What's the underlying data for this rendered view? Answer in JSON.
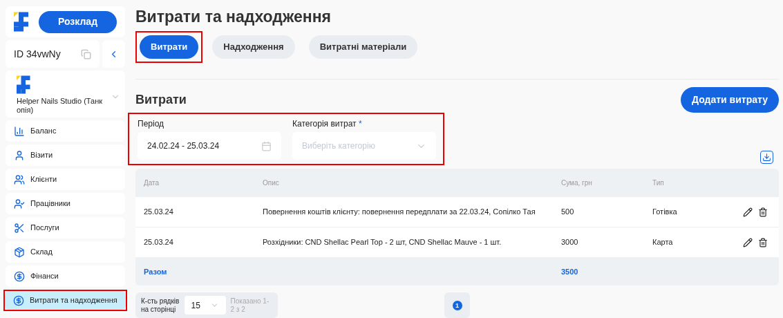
{
  "sidebar": {
    "schedule_button": "Розклад",
    "account_id": "ID 34vwNy",
    "studio": "Helper Nails Studio (Танкопія)",
    "items": [
      {
        "label": "Баланс",
        "selected": false,
        "highlighted": false
      },
      {
        "label": "Візити",
        "selected": false,
        "highlighted": false
      },
      {
        "label": "Клієнти",
        "selected": false,
        "highlighted": false
      },
      {
        "label": "Працівники",
        "selected": false,
        "highlighted": false
      },
      {
        "label": "Послуги",
        "selected": false,
        "highlighted": false
      },
      {
        "label": "Склад",
        "selected": false,
        "highlighted": false
      },
      {
        "label": "Фінанси",
        "selected": false,
        "highlighted": false
      },
      {
        "label": "Витрати та надходження",
        "selected": true,
        "highlighted": true
      }
    ]
  },
  "page_title": "Витрати та надходження",
  "tabs": [
    {
      "label": "Витрати",
      "selected": true,
      "highlighted": true
    },
    {
      "label": "Надходження",
      "selected": false,
      "highlighted": false
    },
    {
      "label": "Витратні матеріали",
      "selected": false,
      "highlighted": false
    }
  ],
  "section_title": "Витрати",
  "add_button": "Додати витрату",
  "filters": {
    "highlighted": true,
    "period": {
      "label": "Період",
      "value": "24.02.24 - 25.03.24"
    },
    "category": {
      "label": "Категорія витрат",
      "required_mark": "*",
      "placeholder": "Виберіть категорію"
    }
  },
  "table": {
    "columns": [
      "Дата",
      "Опис",
      "Сума, грн",
      "Тип"
    ],
    "rows": [
      [
        "25.03.24",
        "Повернення коштів клієнту: повернення передплати за 22.03.24, Сопілко Тая",
        "500",
        "Готівка"
      ],
      [
        "25.03.24",
        "Розхідники: CND Shellac Pearl Top - 2 шт, CND Shellac Mauve - 1 шт.",
        "3000",
        "Карта"
      ]
    ],
    "total": {
      "label": "Разом",
      "amount": "3500"
    }
  },
  "footer": {
    "rows_label": "К-сть рядків на сторінці",
    "rows_value": "15",
    "shown": "Показано 1-2 з 2",
    "pages": [
      {
        "label": "1",
        "selected": true
      }
    ]
  }
}
